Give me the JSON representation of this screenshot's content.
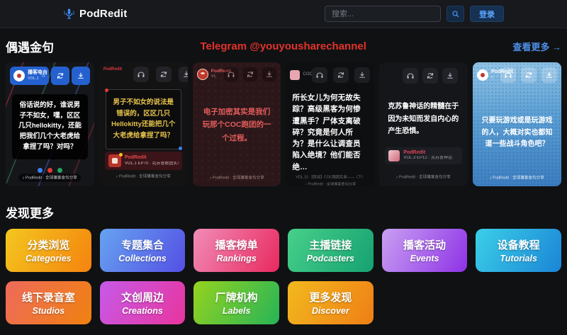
{
  "colors": {
    "watermark": "#e3322b",
    "accent": "#4da3ff",
    "link": "#4d8fe8"
  },
  "header": {
    "title": "PodRedit",
    "search": {
      "placeholder": "搜索..."
    },
    "login_label": "登录"
  },
  "quotes": {
    "heading": "偶遇金句",
    "watermark": "Telegram @youyousharechannel",
    "view_more": "查看更多 →",
    "cards": [
      {
        "podcast": "播客电台",
        "podcast_sub": "VOL.1 · 金句分享",
        "quote": "俗话说的好，谁说男子不如女，嘿，区区几只hellokitty，还能把我们几个大老虎给拿捏了吗？对吗？",
        "footer": "♪ PodRedit · 全球播客金句分享"
      },
      {
        "label": "PodRedit",
        "quote": "男子不如女的说法是错误的，区区几只Hellokitty还能把几个大老虎给拿捏了吗？",
        "podcast": "PodRedit",
        "episode": "VOL.1 EP70 · 克苏鲁跑团实录",
        "footer": "♪ PodRedit · 全球播客金句分享"
      },
      {
        "podcast": "PodRedit",
        "podcast_sub": "VOL.2 · 金句",
        "quote": "电子加密其实是我们玩那个COC跑团的一个过程。",
        "footer": "♪ PodRedit · 全球播客金句分享"
      },
      {
        "podcast": "COC跑团",
        "quote": "所长女儿为何无故失踪？高级黑客为何惨遭黑手？尸体支离破碎？究竟是何人所为？是什么让调查员陷入绝境？他们能否绝…",
        "episode": "VOL.10 【怪谈】COC跑团实录——（下）",
        "footer": "♪ PodRedit · 全球播客金句分享"
      },
      {
        "quote": "克苏鲁神话的精髓在于因为未知而发自内心的产生恐惧。",
        "podcast": "PodRedit",
        "episode": "VOL.3 EP12 · 克苏鲁神话",
        "footer": "♪ PodRedit · 全球播客金句分享"
      },
      {
        "podcast": "PodRedit",
        "podcast_sub": "怪谈 · 金句",
        "quote": "只要玩游戏或是玩游戏的人，大概对实也都知道一些战斗角色吧？",
        "footer": "♪ PodRedit · 全球播客金句分享"
      }
    ]
  },
  "discover": {
    "heading": "发现更多",
    "buttons": [
      {
        "zh": "分类浏览",
        "en": "Categories",
        "from": "#f3c71f",
        "to": "#f5830e"
      },
      {
        "zh": "专题集合",
        "en": "Collections",
        "from": "#66a3f0",
        "to": "#5450e4"
      },
      {
        "zh": "播客榜单",
        "en": "Rankings",
        "from": "#f08cb8",
        "to": "#e9295e"
      },
      {
        "zh": "主播链接",
        "en": "Podcasters",
        "from": "#47d089",
        "to": "#16a172"
      },
      {
        "zh": "播客活动",
        "en": "Events",
        "from": "#c9a0f2",
        "to": "#8e32e6"
      },
      {
        "zh": "设备教程",
        "en": "Tutorials",
        "from": "#3bcfe8",
        "to": "#1b85d6"
      },
      {
        "zh": "线下录音室",
        "en": "Studios",
        "from": "#ee6a5b",
        "to": "#f0810f"
      },
      {
        "zh": "文创周边",
        "en": "Creations",
        "from": "#c65ae8",
        "to": "#e8359e"
      },
      {
        "zh": "厂牌机构",
        "en": "Labels",
        "from": "#95d31f",
        "to": "#27b457"
      },
      {
        "zh": "更多发现",
        "en": "Discover",
        "from": "#f2b91e",
        "to": "#ef7e16"
      }
    ]
  }
}
